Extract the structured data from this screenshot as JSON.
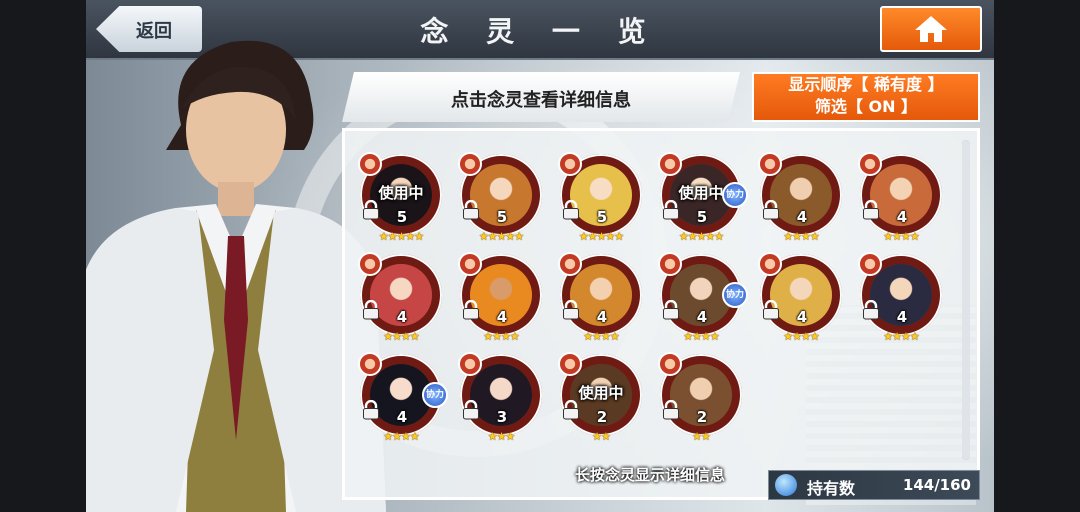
{
  "header": {
    "title": "念 灵 一 览",
    "back_label": "返回"
  },
  "hint": "点击念灵查看详细信息",
  "sort": {
    "order_text": "显示顺序【 稀有度 】",
    "filter_text": "筛选【 ON 】"
  },
  "units": [
    {
      "level": "5",
      "stars": "★★★★★",
      "in_use": "使用中",
      "assist": ""
    },
    {
      "level": "5",
      "stars": "★★★★★",
      "in_use": "",
      "assist": ""
    },
    {
      "level": "5",
      "stars": "★★★★★",
      "in_use": "",
      "assist": ""
    },
    {
      "level": "5",
      "stars": "★★★★★",
      "in_use": "使用中",
      "assist": "协力"
    },
    {
      "level": "4",
      "stars": "★★★★",
      "in_use": "",
      "assist": ""
    },
    {
      "level": "4",
      "stars": "★★★★",
      "in_use": "",
      "assist": ""
    },
    {
      "level": "4",
      "stars": "★★★★",
      "in_use": "",
      "assist": ""
    },
    {
      "level": "4",
      "stars": "★★★★",
      "in_use": "",
      "assist": ""
    },
    {
      "level": "4",
      "stars": "★★★★",
      "in_use": "",
      "assist": ""
    },
    {
      "level": "4",
      "stars": "★★★★",
      "in_use": "",
      "assist": "协力"
    },
    {
      "level": "4",
      "stars": "★★★★",
      "in_use": "",
      "assist": ""
    },
    {
      "level": "4",
      "stars": "★★★★",
      "in_use": "",
      "assist": ""
    },
    {
      "level": "4",
      "stars": "★★★★",
      "in_use": "",
      "assist": "协力"
    },
    {
      "level": "3",
      "stars": "★★★",
      "in_use": "",
      "assist": ""
    },
    {
      "level": "2",
      "stars": "★★",
      "in_use": "使用中",
      "assist": ""
    },
    {
      "level": "2",
      "stars": "★★",
      "in_use": "",
      "assist": ""
    }
  ],
  "footer": {
    "long_press_hint": "长按念灵显示详细信息",
    "holding_label": "持有数",
    "holding_count": "144/160"
  }
}
